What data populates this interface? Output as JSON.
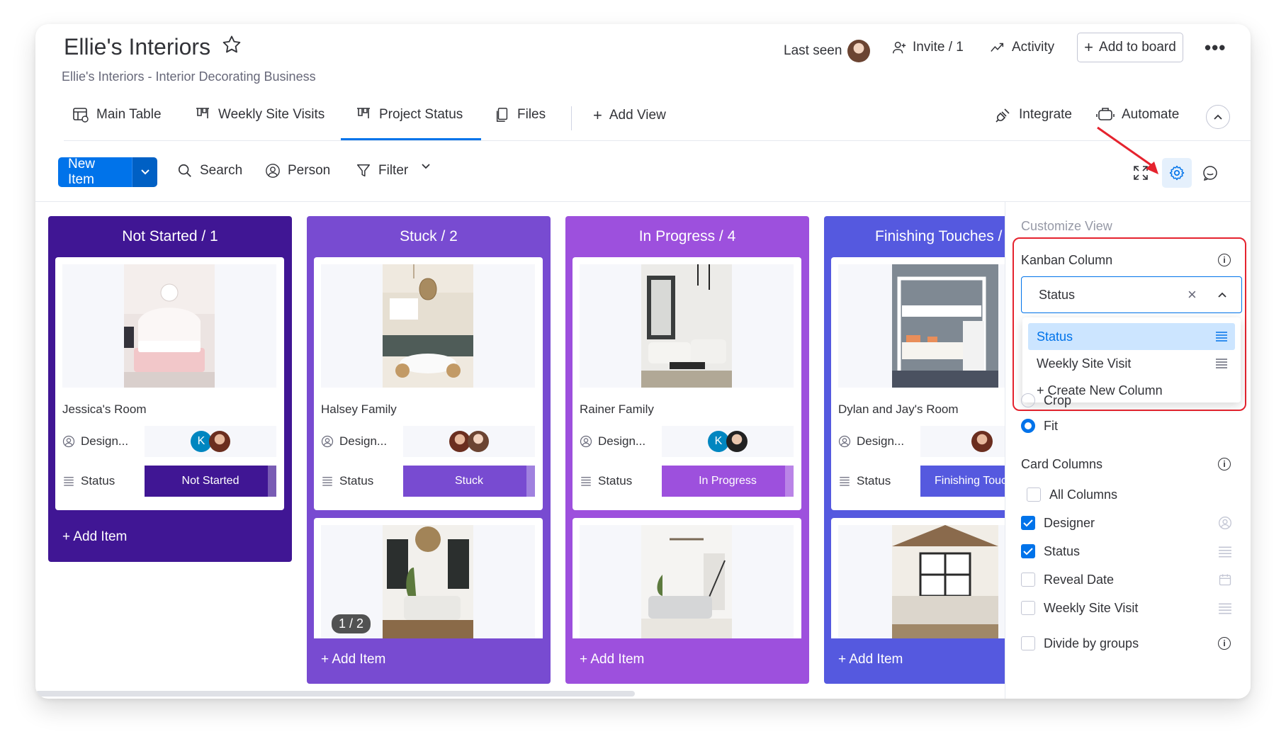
{
  "header": {
    "title": "Ellie's Interiors",
    "subtitle": "Ellie's Interiors - Interior Decorating Business",
    "last_seen": "Last seen",
    "invite": "Invite / 1",
    "activity": "Activity",
    "add_to_board": "Add to board"
  },
  "tabs": [
    {
      "label": "Main Table"
    },
    {
      "label": "Weekly Site Visits"
    },
    {
      "label": "Project Status"
    },
    {
      "label": "Files"
    },
    {
      "label": "Add View"
    }
  ],
  "tabs_right": {
    "integrate": "Integrate",
    "automate": "Automate"
  },
  "toolbar": {
    "new_item": "New Item",
    "search": "Search",
    "person": "Person",
    "filter": "Filter"
  },
  "columns": [
    {
      "header": "Not Started / 1",
      "color": "#401694",
      "add_item": "+ Add Item",
      "cards": [
        {
          "name": "Jessica's Room",
          "designer_label": "Design...",
          "status_label": "Status",
          "status": "Not Started",
          "status_color": "#401694"
        }
      ]
    },
    {
      "header": "Stuck / 2",
      "color": "#784bd1",
      "add_item": "+ Add Item",
      "cards": [
        {
          "name": "Halsey Family",
          "designer_label": "Design...",
          "status_label": "Status",
          "status": "Stuck",
          "status_color": "#784bd1"
        },
        {
          "image_counter": "1 / 2"
        }
      ]
    },
    {
      "header": "In Progress / 4",
      "color": "#9d50dd",
      "add_item": "+ Add Item",
      "cards": [
        {
          "name": "Rainer Family",
          "designer_label": "Design...",
          "status_label": "Status",
          "status": "In Progress",
          "status_color": "#9d50dd"
        },
        {}
      ]
    },
    {
      "header": "Finishing Touches /",
      "color": "#5559df",
      "add_item": "+ Add Item",
      "cards": [
        {
          "name": "Dylan and Jay's Room",
          "designer_label": "Design...",
          "status_label": "Status",
          "status": "Finishing Touc",
          "status_color": "#5559df"
        },
        {}
      ]
    }
  ],
  "avatar_initial": "K",
  "panel": {
    "title": "Customize View",
    "kanban_column": "Kanban Column",
    "selected": "Status",
    "options": [
      "Status",
      "Weekly Site Visit",
      "+ Create New Column"
    ],
    "crop": "Crop",
    "fit": "Fit",
    "card_columns": "Card Columns",
    "card_column_items": [
      {
        "label": "All Columns",
        "checked": false
      },
      {
        "label": "Designer",
        "checked": true
      },
      {
        "label": "Status",
        "checked": true
      },
      {
        "label": "Reveal Date",
        "checked": false
      },
      {
        "label": "Weekly Site Visit",
        "checked": false
      }
    ],
    "divide_by_groups": "Divide by groups"
  },
  "colors": {
    "accent": "#0073ea",
    "highlight": "#e5232e"
  }
}
